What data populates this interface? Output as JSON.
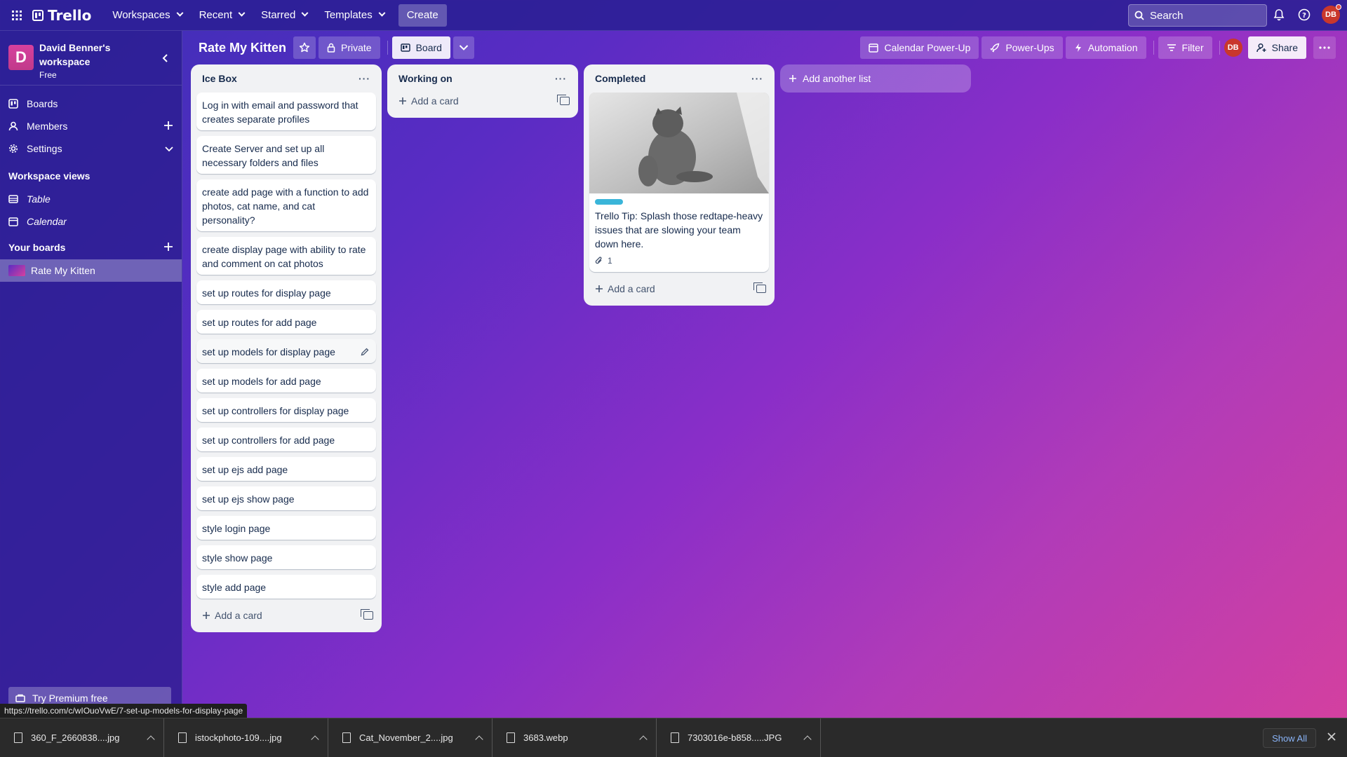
{
  "topnav": {
    "logo": "Trello",
    "items": [
      "Workspaces",
      "Recent",
      "Starred",
      "Templates"
    ],
    "create": "Create",
    "search_placeholder": "Search",
    "avatar": "DB"
  },
  "sidebar": {
    "workspace_initial": "D",
    "workspace_name": "David Benner's workspace",
    "workspace_plan": "Free",
    "items": [
      {
        "label": "Boards",
        "icon": "board-icon"
      },
      {
        "label": "Members",
        "icon": "person-icon"
      },
      {
        "label": "Settings",
        "icon": "gear-icon"
      }
    ],
    "views_title": "Workspace views",
    "views": [
      "Table",
      "Calendar"
    ],
    "your_boards_title": "Your boards",
    "boards": [
      "Rate My Kitten"
    ],
    "premium": "Try Premium free"
  },
  "board": {
    "title": "Rate My Kitten",
    "visibility": "Private",
    "view": "Board",
    "buttons": [
      "Calendar Power-Up",
      "Power-Ups",
      "Automation",
      "Filter"
    ],
    "avatar": "DB",
    "share": "Share"
  },
  "lists": [
    {
      "title": "Ice Box",
      "cards": [
        "Log in with email and password that creates separate profiles",
        "Create Server and set up all necessary folders and files",
        "create add page with a function to add photos, cat name, and cat personality?",
        "create display page with ability to rate and comment on cat photos",
        "set up routes for display page",
        "set up routes for add page",
        "set up models for display page",
        "set up models for add page",
        "set up controllers for display page",
        "set up controllers for add page",
        "set up ejs add page",
        "set up ejs show page",
        "style login page",
        "style show page",
        "style add page"
      ],
      "add": "Add a card"
    },
    {
      "title": "Working on",
      "cards": [],
      "add": "Add a card"
    },
    {
      "title": "Completed",
      "cards": [
        "Trello Tip: Splash those redtape-heavy issues that are slowing your team down here."
      ],
      "attachments": "1",
      "add": "Add a card"
    }
  ],
  "add_list": "Add another list",
  "status_url": "https://trello.com/c/wIOuoVwE/7-set-up-models-for-display-page",
  "downloads": {
    "items": [
      "360_F_2660838....jpg",
      "istockphoto-109....jpg",
      "Cat_November_2....jpg",
      "3683.webp",
      "7303016e-b858.....JPG"
    ],
    "show_all": "Show All"
  },
  "colors": {
    "label_cyan": "#3ab5d9",
    "avatar_red": "#c9372c",
    "workspace_pink": "#d6409e"
  }
}
